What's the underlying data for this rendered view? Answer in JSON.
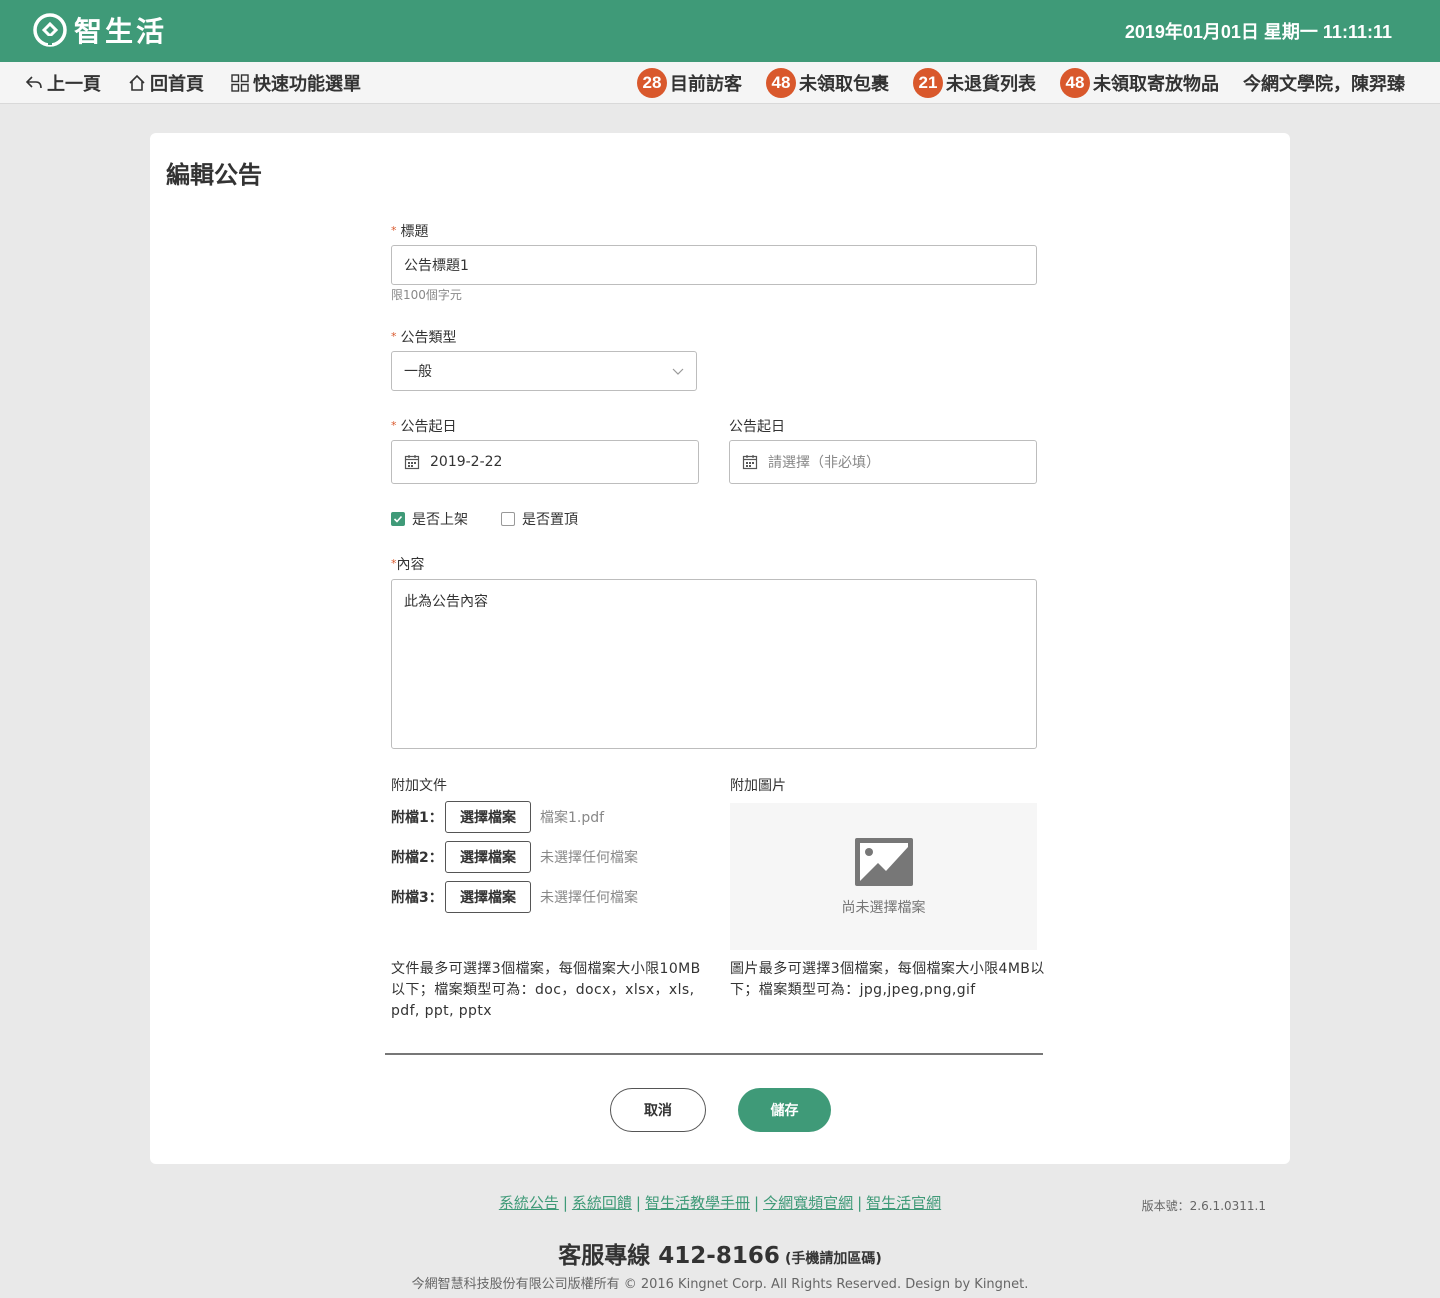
{
  "header": {
    "app_name": "智生活",
    "datetime": "2019年01月01日 星期一 11:11:11"
  },
  "nav": {
    "back_label": "上一頁",
    "home_label": "回首頁",
    "quick_menu_label": "快速功能選單"
  },
  "stats": [
    {
      "count": "28",
      "label": "目前訪客"
    },
    {
      "count": "48",
      "label": "未領取包裹"
    },
    {
      "count": "21",
      "label": "未退貨列表"
    },
    {
      "count": "48",
      "label": "未領取寄放物品"
    }
  ],
  "user": "今網文學院，陳羿臻",
  "page": {
    "title": "編輯公告"
  },
  "form": {
    "title_label": "標題",
    "title_value": "公告標題1",
    "title_hint": "限100個字元",
    "type_label": "公告類型",
    "type_value": "一般",
    "start_label": "公告起日",
    "start_value": "2019-2-22",
    "end_label": "公告起日",
    "end_placeholder": "請選擇（非必填）",
    "publish_label": "是否上架",
    "publish_checked": true,
    "pin_label": "是否置頂",
    "pin_checked": false,
    "content_label": "內容",
    "content_value": "此為公告內容",
    "files_label": "附加文件",
    "choose_file_label": "選擇檔案",
    "files": [
      {
        "label": "附檔1：",
        "name": "檔案1.pdf"
      },
      {
        "label": "附檔2：",
        "name": "未選擇任何檔案"
      },
      {
        "label": "附檔3：",
        "name": "未選擇任何檔案"
      }
    ],
    "files_note": "文件最多可選擇3個檔案，每個檔案大小限10MB以下；檔案類型可為：doc，docx，xlsx，xls, pdf, ppt, pptx",
    "images_label": "附加圖片",
    "images_empty": "尚未選擇檔案",
    "images_note": "圖片最多可選擇3個檔案，每個檔案大小限4MB以下；檔案類型可為：jpg,jpeg,png,gif",
    "cancel_label": "取消",
    "save_label": "儲存"
  },
  "footer": {
    "links": [
      "系統公告",
      "系統回饋",
      "智生活教學手冊",
      "今網寬頻官網",
      "智生活官網"
    ],
    "version": "版本號：2.6.1.0311.1",
    "hotline": "客服專線 412-8166",
    "hotline_note": "(手機請加區碼)",
    "copyright": "今網智慧科技股份有限公司版權所有 © 2016 Kingnet Corp. All Rights Reserved. Design by Kingnet."
  },
  "colors": {
    "brand_green": "#3f9a78",
    "badge_orange": "#d9582c"
  }
}
